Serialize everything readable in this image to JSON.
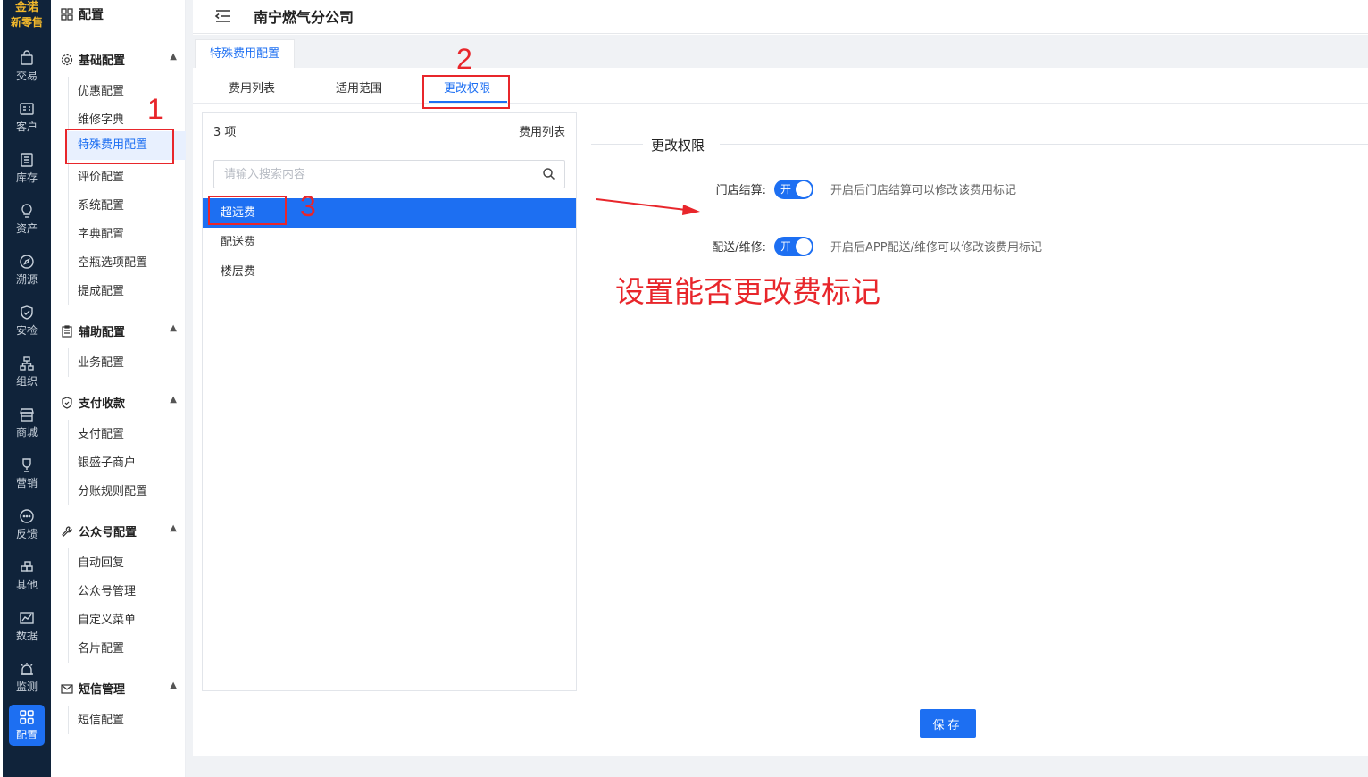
{
  "rail": {
    "logo_line1": "金诺",
    "logo_line2": "新零售",
    "items": [
      {
        "label": "交易",
        "icon": "bag-icon"
      },
      {
        "label": "客户",
        "icon": "id-card-icon"
      },
      {
        "label": "库存",
        "icon": "inventory-icon"
      },
      {
        "label": "资产",
        "icon": "lightbulb-icon"
      },
      {
        "label": "溯源",
        "icon": "compass-icon"
      },
      {
        "label": "安检",
        "icon": "shield-check-icon"
      },
      {
        "label": "组织",
        "icon": "org-chart-icon"
      },
      {
        "label": "商城",
        "icon": "store-icon"
      },
      {
        "label": "营销",
        "icon": "trophy-icon"
      },
      {
        "label": "反馈",
        "icon": "chat-bubble-icon"
      },
      {
        "label": "其他",
        "icon": "blocks-icon"
      },
      {
        "label": "数据",
        "icon": "line-chart-icon"
      },
      {
        "label": "监测",
        "icon": "alarm-icon"
      },
      {
        "label": "配置",
        "icon": "grid-icon"
      }
    ]
  },
  "submenu": {
    "title": "配置",
    "groups": [
      {
        "title": "基础配置",
        "items": [
          "优惠配置",
          "维修字典",
          "特殊费用配置",
          "评价配置",
          "系统配置",
          "字典配置",
          "空瓶选项配置",
          "提成配置"
        ]
      },
      {
        "title": "辅助配置",
        "items": [
          "业务配置"
        ]
      },
      {
        "title": "支付收款",
        "items": [
          "支付配置",
          "银盛子商户",
          "分账规则配置"
        ]
      },
      {
        "title": "公众号配置",
        "items": [
          "自动回复",
          "公众号管理",
          "自定义菜单",
          "名片配置"
        ]
      },
      {
        "title": "短信管理",
        "items": [
          "短信配置"
        ]
      }
    ],
    "active_item": "特殊费用配置"
  },
  "header": {
    "title": "南宁燃气分公司"
  },
  "page_tab": "特殊费用配置",
  "inner_tabs": [
    "费用列表",
    "适用范围",
    "更改权限"
  ],
  "active_inner_tab": "更改权限",
  "list_panel": {
    "count": "3 项",
    "title": "费用列表",
    "search_placeholder": "请输入搜索内容",
    "items": [
      "超远费",
      "配送费",
      "楼层费"
    ],
    "selected": "超远费"
  },
  "permissions": {
    "section_title": "更改权限",
    "rows": [
      {
        "label": "门店结算:",
        "switch_text": "开",
        "on": true,
        "hint": "开启后门店结算可以修改该费用标记"
      },
      {
        "label": "配送/维修:",
        "switch_text": "开",
        "on": true,
        "hint": "开启后APP配送/维修可以修改该费用标记"
      }
    ]
  },
  "save_button": "保存",
  "annotations": {
    "numbers": [
      "1",
      "2",
      "3"
    ],
    "note": "设置能否更改费标记",
    "color": "#e8262b"
  },
  "colors": {
    "primary": "#1d6ff2",
    "rail_bg": "#10233a",
    "logo": "#f4b92b"
  }
}
